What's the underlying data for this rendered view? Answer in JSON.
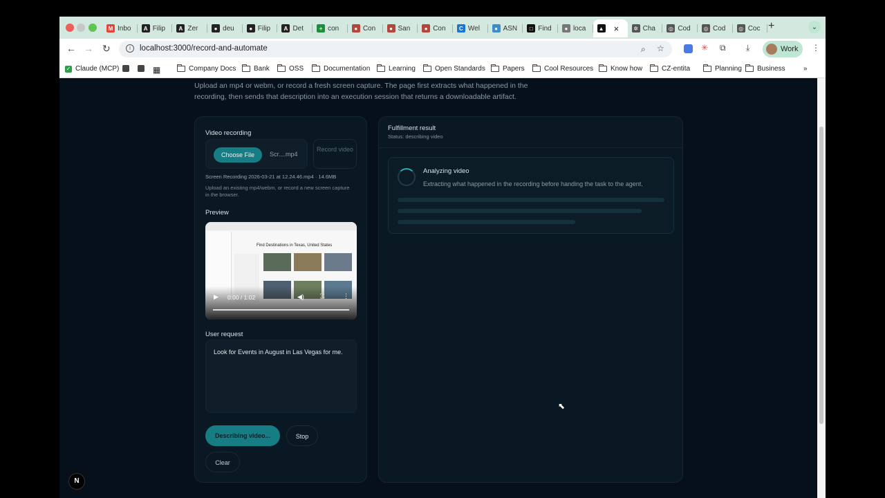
{
  "browser": {
    "tabs": [
      {
        "label": "Inbo",
        "icon": "gmail-icon",
        "color": "#ea4335",
        "glyph": "M"
      },
      {
        "label": "Filip",
        "icon": "linear-icon",
        "color": "#222",
        "glyph": "A"
      },
      {
        "label": "Zer",
        "icon": "linear-icon",
        "color": "#222",
        "glyph": "A"
      },
      {
        "label": "deu",
        "icon": "github-icon",
        "color": "#222",
        "glyph": "●"
      },
      {
        "label": "Filip",
        "icon": "github-icon",
        "color": "#222",
        "glyph": "●"
      },
      {
        "label": "Det",
        "icon": "linear-icon",
        "color": "#222",
        "glyph": "A"
      },
      {
        "label": "con",
        "icon": "sheets-icon",
        "color": "#1e8e3e",
        "glyph": "+"
      },
      {
        "label": "Con",
        "icon": "avatar-icon",
        "color": "#b3473d",
        "glyph": "●"
      },
      {
        "label": "San",
        "icon": "avatar-icon",
        "color": "#b3473d",
        "glyph": "●"
      },
      {
        "label": "Con",
        "icon": "avatar-icon",
        "color": "#b3473d",
        "glyph": "●"
      },
      {
        "label": "Wel",
        "icon": "c-icon",
        "color": "#1976d2",
        "glyph": "C"
      },
      {
        "label": "ASN",
        "icon": "globe-icon",
        "color": "#3b8ec9",
        "glyph": "●"
      },
      {
        "label": "Find",
        "icon": "box-icon",
        "color": "#111",
        "glyph": "□"
      },
      {
        "label": "loca",
        "icon": "globe-icon",
        "color": "#777",
        "glyph": "●"
      },
      {
        "label": "",
        "icon": "vercel-icon",
        "color": "#111",
        "glyph": "▲",
        "active": true
      },
      {
        "label": "Cha",
        "icon": "openai-icon",
        "color": "#555",
        "glyph": "✲"
      },
      {
        "label": "Cod",
        "icon": "openai-icon",
        "color": "#555",
        "glyph": "◎"
      },
      {
        "label": "Cod",
        "icon": "openai-icon",
        "color": "#555",
        "glyph": "◎"
      },
      {
        "label": "Coc",
        "icon": "openai-icon",
        "color": "#555",
        "glyph": "◎"
      }
    ],
    "url": "localhost:3000/record-and-automate",
    "profile_label": "Work",
    "bookmarks": [
      {
        "label": "Claude (MCP)",
        "type": "check"
      },
      {
        "label": "",
        "type": "square"
      },
      {
        "label": "",
        "type": "square"
      },
      {
        "label": "",
        "type": "apps"
      },
      {
        "label": "Company Docs",
        "type": "folder"
      },
      {
        "label": "Bank",
        "type": "folder"
      },
      {
        "label": "OSS",
        "type": "folder"
      },
      {
        "label": "Documentation",
        "type": "folder"
      },
      {
        "label": "Learning",
        "type": "folder"
      },
      {
        "label": "Open Standards",
        "type": "folder"
      },
      {
        "label": "Papers",
        "type": "folder"
      },
      {
        "label": "Cool Resources",
        "type": "folder"
      },
      {
        "label": "Know how",
        "type": "folder"
      },
      {
        "label": "CZ-entita",
        "type": "folder"
      },
      {
        "label": "Planning",
        "type": "folder"
      },
      {
        "label": "Business",
        "type": "folder"
      }
    ]
  },
  "page": {
    "intro": "Upload an mp4 or webm, or record a fresh screen capture. The page first extracts what happened in the recording, then sends that description into an execution session that returns a downloadable artifact.",
    "left": {
      "video_label": "Video recording",
      "choose_file": "Choose File",
      "file_name_short": "Scr....mp4",
      "record_label": "Record video",
      "file_info": "Screen Recording 2026-03-21 at 12.24.46.mp4 · 14.6MB",
      "hint": "Upload an existing mp4/webm, or record a new screen capture in the browser.",
      "preview_label": "Preview",
      "video_title": "Find Destinations in Texas, United States",
      "video_time": "0:00 / 1:02",
      "request_label": "User request",
      "request_value": "Look for Events in August in Las Vegas for me.",
      "describing_button": "Describing video...",
      "stop_button": "Stop",
      "clear_button": "Clear"
    },
    "right": {
      "title": "Fulfillment result",
      "status": "Status: describing video",
      "analyzing_title": "Analyzing video",
      "analyzing_desc": "Extracting what happened in the recording before handing the task to the agent."
    },
    "accent": "#167d85"
  }
}
